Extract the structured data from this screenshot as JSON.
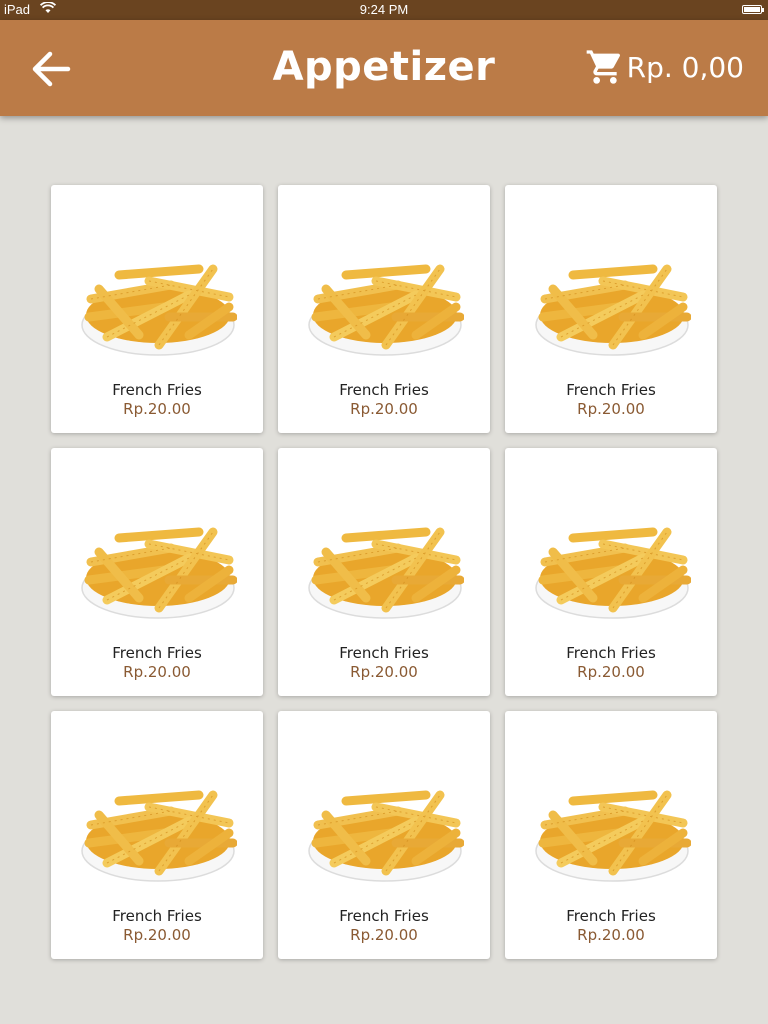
{
  "status_bar": {
    "carrier": "iPad",
    "time": "9:24 PM"
  },
  "header": {
    "title": "Appetizer",
    "cart_total": "Rp. 0,00"
  },
  "colors": {
    "header": "#bb7b47",
    "status_bar": "#6a4420",
    "price": "#8a5a33",
    "background": "#e0dfda"
  },
  "icons": {
    "back": "arrow-left-icon",
    "cart": "shopping-cart-icon",
    "wifi": "wifi-icon",
    "battery": "battery-icon"
  },
  "products": [
    {
      "name": "French Fries",
      "price": "Rp.20.00"
    },
    {
      "name": "French Fries",
      "price": "Rp.20.00"
    },
    {
      "name": "French Fries",
      "price": "Rp.20.00"
    },
    {
      "name": "French Fries",
      "price": "Rp.20.00"
    },
    {
      "name": "French Fries",
      "price": "Rp.20.00"
    },
    {
      "name": "French Fries",
      "price": "Rp.20.00"
    },
    {
      "name": "French Fries",
      "price": "Rp.20.00"
    },
    {
      "name": "French Fries",
      "price": "Rp.20.00"
    },
    {
      "name": "French Fries",
      "price": "Rp.20.00"
    }
  ]
}
